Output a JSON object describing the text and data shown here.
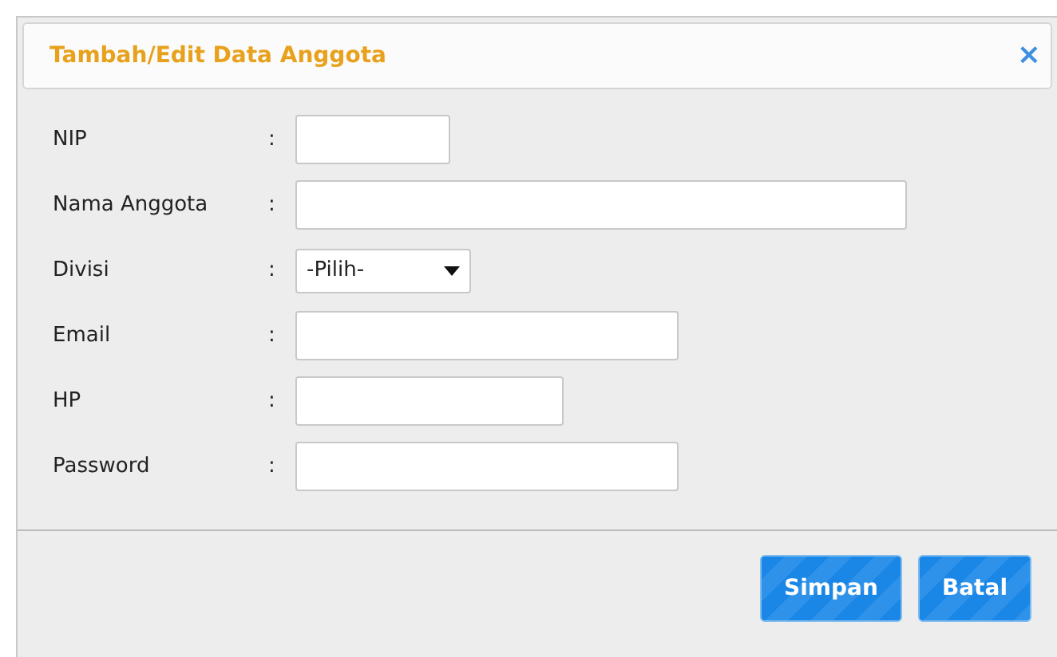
{
  "dialog": {
    "title": "Tambah/Edit Data Anggota",
    "close": "×"
  },
  "fields": [
    {
      "label": "NIP",
      "separator": ":",
      "kind": "input"
    },
    {
      "label": "Nama Anggota",
      "separator": ":",
      "kind": "input"
    },
    {
      "label": "Divisi",
      "separator": ":",
      "kind": "select",
      "value": "-Pilih-"
    },
    {
      "label": "Email",
      "separator": ":",
      "kind": "input"
    },
    {
      "label": "HP",
      "separator": ":",
      "kind": "input"
    },
    {
      "label": "Password",
      "separator": ":",
      "kind": "input"
    }
  ],
  "buttons": [
    "Simpan",
    "Batal"
  ]
}
